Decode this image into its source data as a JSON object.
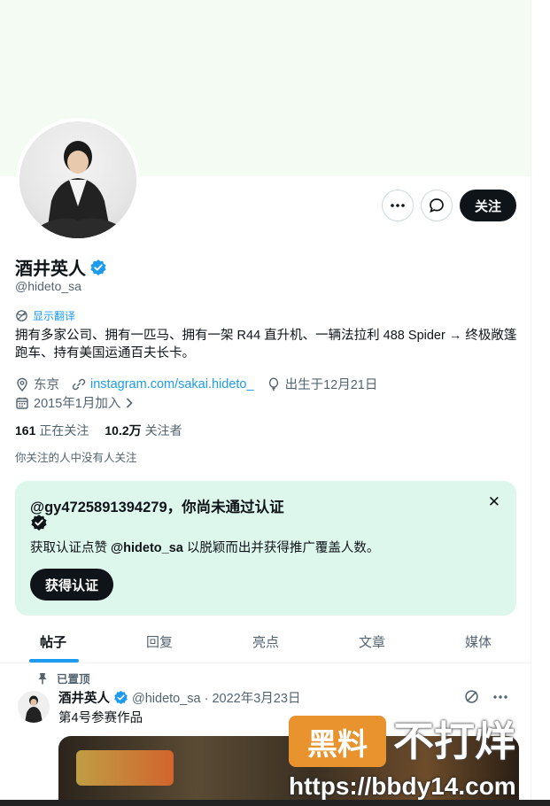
{
  "profile": {
    "name": "酒井英人",
    "handle": "@hideto_sa",
    "translate_label": "显示翻译",
    "bio": "拥有多家公司、拥有一匹马、拥有一架 R44 直升机、一辆法拉利 488 Spider → 终极敞篷跑车、持有美国运通百夫长卡。",
    "location": "东京",
    "link": "instagram.com/sakai.hideto_",
    "birthday": "出生于12月21日",
    "joined": "2015年1月加入",
    "following_count": "161",
    "following_label": "正在关注",
    "followers_count": "10.2万",
    "followers_label": "关注者",
    "no_mutual": "你关注的人中没有人关注"
  },
  "actions": {
    "follow_label": "关注"
  },
  "verify_card": {
    "title": "@gy4725891394279，你尚未通过认证",
    "desc_prefix": "获取认证点赞 ",
    "desc_handle": "@hideto_sa",
    "desc_suffix": " 以脱颖而出并获得推广覆盖人数。",
    "button_label": "获得认证"
  },
  "tabs": [
    {
      "label": "帖子"
    },
    {
      "label": "回复"
    },
    {
      "label": "亮点"
    },
    {
      "label": "文章"
    },
    {
      "label": "媒体"
    }
  ],
  "pinned_tweet": {
    "pinned_label": "已置顶",
    "name": "酒井英人",
    "handle_date": "@hideto_sa · 2022年3月23日",
    "text": "第4号参赛作品"
  },
  "watermark": {
    "badge": "黑料",
    "text": "不打烊",
    "url": "https://bbdy14.com"
  },
  "colors": {
    "accent": "#1d9bf0",
    "verify_bg": "#def7ec",
    "banner": "#f3fbf3"
  }
}
